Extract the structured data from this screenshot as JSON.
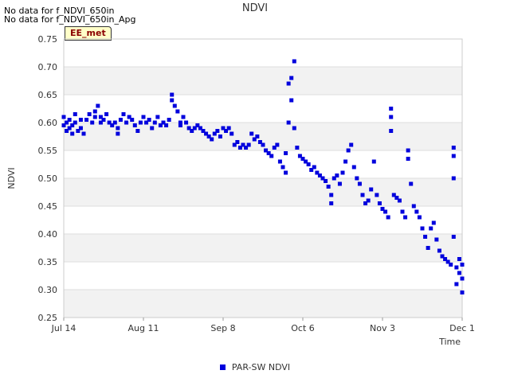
{
  "no_data_messages": [
    "No data for f_NDVI_650in",
    "No data for f_NDVI_650in_Apg"
  ],
  "station_tag": "EE_met",
  "colors": {
    "series": "#0000dd",
    "band": "#f2f2f2",
    "grid": "#dddddd"
  },
  "chart_data": {
    "type": "scatter",
    "title": "NDVI",
    "xlabel": "Time",
    "ylabel": "NDVI",
    "x_range": [
      "Jul 14",
      "Dec 1"
    ],
    "x_ticks": [
      "Jul 14",
      "Aug 11",
      "Sep 8",
      "Oct 6",
      "Nov 3",
      "Dec 1"
    ],
    "ylim": [
      0.25,
      0.75
    ],
    "y_ticks": [
      "0.25",
      "0.30",
      "0.35",
      "0.40",
      "0.45",
      "0.50",
      "0.55",
      "0.60",
      "0.65",
      "0.70",
      "0.75"
    ],
    "legend_position": "bottom",
    "series": [
      {
        "name": "PAR-SW NDVI",
        "points": [
          [
            "Jul 14",
            0.595
          ],
          [
            "Jul 14",
            0.61
          ],
          [
            "Jul 15",
            0.585
          ],
          [
            "Jul 15",
            0.6
          ],
          [
            "Jul 16",
            0.59
          ],
          [
            "Jul 16",
            0.605
          ],
          [
            "Jul 17",
            0.58
          ],
          [
            "Jul 17",
            0.595
          ],
          [
            "Jul 18",
            0.6
          ],
          [
            "Jul 18",
            0.615
          ],
          [
            "Jul 19",
            0.585
          ],
          [
            "Jul 20",
            0.605
          ],
          [
            "Jul 20",
            0.59
          ],
          [
            "Jul 21",
            0.58
          ],
          [
            "Jul 22",
            0.605
          ],
          [
            "Jul 23",
            0.615
          ],
          [
            "Jul 24",
            0.6
          ],
          [
            "Jul 25",
            0.62
          ],
          [
            "Jul 25",
            0.61
          ],
          [
            "Jul 26",
            0.63
          ],
          [
            "Jul 27",
            0.61
          ],
          [
            "Jul 27",
            0.6
          ],
          [
            "Jul 28",
            0.605
          ],
          [
            "Jul 29",
            0.615
          ],
          [
            "Jul 30",
            0.6
          ],
          [
            "Jul 31",
            0.595
          ],
          [
            "Aug 1",
            0.6
          ],
          [
            "Aug 2",
            0.59
          ],
          [
            "Aug 2",
            0.58
          ],
          [
            "Aug 3",
            0.605
          ],
          [
            "Aug 4",
            0.615
          ],
          [
            "Aug 5",
            0.6
          ],
          [
            "Aug 6",
            0.61
          ],
          [
            "Aug 7",
            0.605
          ],
          [
            "Aug 8",
            0.595
          ],
          [
            "Aug 9",
            0.585
          ],
          [
            "Aug 10",
            0.6
          ],
          [
            "Aug 11",
            0.61
          ],
          [
            "Aug 12",
            0.6
          ],
          [
            "Aug 13",
            0.605
          ],
          [
            "Aug 14",
            0.59
          ],
          [
            "Aug 15",
            0.6
          ],
          [
            "Aug 16",
            0.61
          ],
          [
            "Aug 17",
            0.595
          ],
          [
            "Aug 18",
            0.6
          ],
          [
            "Aug 19",
            0.595
          ],
          [
            "Aug 20",
            0.605
          ],
          [
            "Aug 21",
            0.65
          ],
          [
            "Aug 21",
            0.64
          ],
          [
            "Aug 22",
            0.63
          ],
          [
            "Aug 23",
            0.62
          ],
          [
            "Aug 24",
            0.6
          ],
          [
            "Aug 24",
            0.595
          ],
          [
            "Aug 25",
            0.61
          ],
          [
            "Aug 26",
            0.6
          ],
          [
            "Aug 27",
            0.59
          ],
          [
            "Aug 28",
            0.585
          ],
          [
            "Aug 29",
            0.59
          ],
          [
            "Aug 30",
            0.595
          ],
          [
            "Aug 31",
            0.59
          ],
          [
            "Sep 1",
            0.585
          ],
          [
            "Sep 2",
            0.58
          ],
          [
            "Sep 3",
            0.575
          ],
          [
            "Sep 4",
            0.57
          ],
          [
            "Sep 5",
            0.58
          ],
          [
            "Sep 6",
            0.585
          ],
          [
            "Sep 7",
            0.575
          ],
          [
            "Sep 8",
            0.59
          ],
          [
            "Sep 9",
            0.585
          ],
          [
            "Sep 10",
            0.59
          ],
          [
            "Sep 11",
            0.58
          ],
          [
            "Sep 12",
            0.56
          ],
          [
            "Sep 13",
            0.565
          ],
          [
            "Sep 14",
            0.555
          ],
          [
            "Sep 15",
            0.56
          ],
          [
            "Sep 16",
            0.555
          ],
          [
            "Sep 17",
            0.56
          ],
          [
            "Sep 18",
            0.58
          ],
          [
            "Sep 19",
            0.57
          ],
          [
            "Sep 20",
            0.575
          ],
          [
            "Sep 21",
            0.565
          ],
          [
            "Sep 22",
            0.56
          ],
          [
            "Sep 23",
            0.55
          ],
          [
            "Sep 24",
            0.545
          ],
          [
            "Sep 25",
            0.54
          ],
          [
            "Sep 26",
            0.555
          ],
          [
            "Sep 27",
            0.56
          ],
          [
            "Sep 28",
            0.53
          ],
          [
            "Sep 29",
            0.52
          ],
          [
            "Sep 30",
            0.51
          ],
          [
            "Sep 30",
            0.545
          ],
          [
            "Oct 1",
            0.67
          ],
          [
            "Oct 1",
            0.6
          ],
          [
            "Oct 2",
            0.68
          ],
          [
            "Oct 2",
            0.64
          ],
          [
            "Oct 3",
            0.71
          ],
          [
            "Oct 3",
            0.59
          ],
          [
            "Oct 4",
            0.555
          ],
          [
            "Oct 5",
            0.54
          ],
          [
            "Oct 6",
            0.535
          ],
          [
            "Oct 7",
            0.53
          ],
          [
            "Oct 8",
            0.525
          ],
          [
            "Oct 9",
            0.515
          ],
          [
            "Oct 10",
            0.52
          ],
          [
            "Oct 11",
            0.51
          ],
          [
            "Oct 12",
            0.505
          ],
          [
            "Oct 13",
            0.5
          ],
          [
            "Oct 14",
            0.495
          ],
          [
            "Oct 15",
            0.485
          ],
          [
            "Oct 16",
            0.47
          ],
          [
            "Oct 16",
            0.455
          ],
          [
            "Oct 17",
            0.5
          ],
          [
            "Oct 18",
            0.505
          ],
          [
            "Oct 19",
            0.49
          ],
          [
            "Oct 20",
            0.51
          ],
          [
            "Oct 21",
            0.53
          ],
          [
            "Oct 22",
            0.55
          ],
          [
            "Oct 23",
            0.56
          ],
          [
            "Oct 24",
            0.52
          ],
          [
            "Oct 25",
            0.5
          ],
          [
            "Oct 26",
            0.49
          ],
          [
            "Oct 27",
            0.47
          ],
          [
            "Oct 28",
            0.455
          ],
          [
            "Oct 29",
            0.46
          ],
          [
            "Oct 30",
            0.48
          ],
          [
            "Oct 31",
            0.53
          ],
          [
            "Nov 1",
            0.47
          ],
          [
            "Nov 2",
            0.455
          ],
          [
            "Nov 3",
            0.445
          ],
          [
            "Nov 4",
            0.44
          ],
          [
            "Nov 5",
            0.43
          ],
          [
            "Nov 6",
            0.625
          ],
          [
            "Nov 6",
            0.61
          ],
          [
            "Nov 6",
            0.585
          ],
          [
            "Nov 7",
            0.47
          ],
          [
            "Nov 8",
            0.465
          ],
          [
            "Nov 9",
            0.46
          ],
          [
            "Nov 10",
            0.44
          ],
          [
            "Nov 11",
            0.43
          ],
          [
            "Nov 12",
            0.55
          ],
          [
            "Nov 12",
            0.535
          ],
          [
            "Nov 13",
            0.49
          ],
          [
            "Nov 14",
            0.45
          ],
          [
            "Nov 15",
            0.44
          ],
          [
            "Nov 16",
            0.43
          ],
          [
            "Nov 17",
            0.41
          ],
          [
            "Nov 18",
            0.395
          ],
          [
            "Nov 19",
            0.375
          ],
          [
            "Nov 20",
            0.41
          ],
          [
            "Nov 21",
            0.42
          ],
          [
            "Nov 22",
            0.39
          ],
          [
            "Nov 23",
            0.37
          ],
          [
            "Nov 24",
            0.36
          ],
          [
            "Nov 25",
            0.355
          ],
          [
            "Nov 26",
            0.35
          ],
          [
            "Nov 27",
            0.345
          ],
          [
            "Nov 28",
            0.555
          ],
          [
            "Nov 28",
            0.54
          ],
          [
            "Nov 28",
            0.5
          ],
          [
            "Nov 28",
            0.395
          ],
          [
            "Nov 29",
            0.31
          ],
          [
            "Nov 29",
            0.34
          ],
          [
            "Nov 30",
            0.355
          ],
          [
            "Nov 30",
            0.33
          ],
          [
            "Dec 1",
            0.345
          ],
          [
            "Dec 1",
            0.32
          ],
          [
            "Dec 1",
            0.295
          ]
        ]
      }
    ]
  }
}
